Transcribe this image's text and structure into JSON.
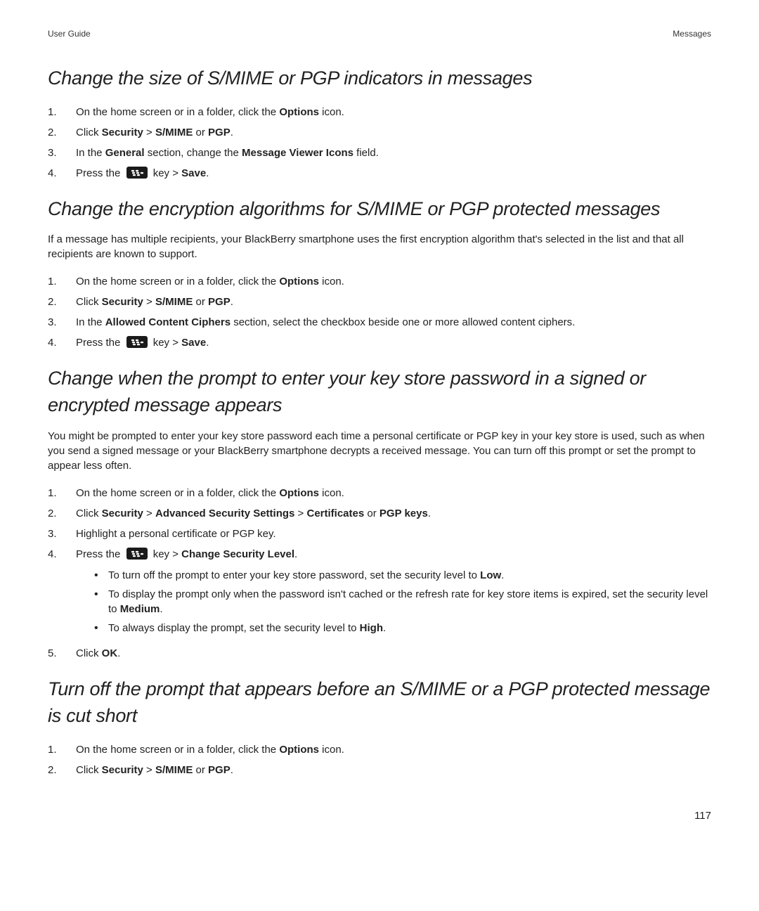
{
  "header": {
    "left": "User Guide",
    "right": "Messages"
  },
  "sections": [
    {
      "heading": "Change the size of S/MIME or PGP indicators in messages",
      "steps": [
        {
          "n": "1.",
          "html": "On the home screen or in a folder, click the <strong>Options</strong> icon."
        },
        {
          "n": "2.",
          "html": "Click <strong>Security</strong> > <strong>S/MIME</strong> or <strong>PGP</strong>."
        },
        {
          "n": "3.",
          "html": "In the <strong>General</strong> section, change the <strong>Message Viewer Icons</strong> field."
        },
        {
          "n": "4.",
          "html": "Press the {{BBKEY}} key > <strong>Save</strong>."
        }
      ]
    },
    {
      "heading": "Change the encryption algorithms for S/MIME or PGP protected messages",
      "body": "If a message has multiple recipients, your BlackBerry smartphone uses the first encryption algorithm that's selected in the list and that all recipients are known to support.",
      "steps": [
        {
          "n": "1.",
          "html": "On the home screen or in a folder, click the <strong>Options</strong> icon."
        },
        {
          "n": "2.",
          "html": "Click <strong>Security</strong> > <strong>S/MIME</strong> or <strong>PGP</strong>."
        },
        {
          "n": "3.",
          "html": "In the <strong>Allowed Content Ciphers</strong> section, select the checkbox beside one or more allowed content ciphers."
        },
        {
          "n": "4.",
          "html": "Press the {{BBKEY}} key > <strong>Save</strong>."
        }
      ]
    },
    {
      "heading": "Change when the prompt to enter your key store password in a signed or encrypted message appears",
      "body": "You might be prompted to enter your key store password each time a personal certificate or PGP key in your key store is used, such as when you send a signed message or your BlackBerry smartphone decrypts a received message. You can turn off this prompt or set the prompt to appear less often.",
      "steps": [
        {
          "n": "1.",
          "html": "On the home screen or in a folder, click the <strong>Options</strong> icon."
        },
        {
          "n": "2.",
          "html": "Click <strong>Security</strong> > <strong>Advanced Security Settings</strong> > <strong>Certificates</strong> or <strong>PGP keys</strong>."
        },
        {
          "n": "3.",
          "html": "Highlight a personal certificate or PGP key."
        },
        {
          "n": "4.",
          "html": "Press the {{BBKEY}} key > <strong>Change Security Level</strong>.",
          "bullets": [
            "To turn off the prompt to enter your key store password, set the security level to <strong>Low</strong>.",
            "To display the prompt only when the password isn't cached or the refresh rate for key store items is expired, set the security level to <strong>Medium</strong>.",
            "To always display the prompt, set the security level to <strong>High</strong>."
          ]
        },
        {
          "n": "5.",
          "html": "Click <strong>OK</strong>."
        }
      ]
    },
    {
      "heading": "Turn off the prompt that appears before an S/MIME or a PGP protected message is cut short",
      "steps": [
        {
          "n": "1.",
          "html": "On the home screen or in a folder, click the <strong>Options</strong> icon."
        },
        {
          "n": "2.",
          "html": "Click <strong>Security</strong> > <strong>S/MIME</strong> or <strong>PGP</strong>."
        }
      ]
    }
  ],
  "pageNumber": "117",
  "icons": {
    "bbkey": "blackberry-menu-key-icon"
  }
}
